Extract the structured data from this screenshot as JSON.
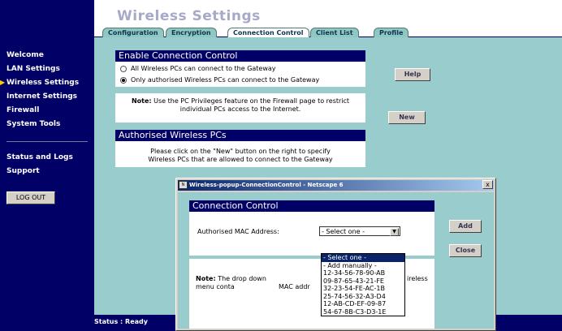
{
  "page_title": "Wireless Settings",
  "tabs": [
    "Configuration",
    "Encryption",
    "Connection Control",
    "Client List",
    "Profile"
  ],
  "sidebar": {
    "items": [
      "Welcome",
      "LAN Settings",
      "Wireless Settings",
      "Internet Settings",
      "Firewall",
      "System Tools"
    ],
    "items2": [
      "Status and Logs",
      "Support"
    ],
    "active_item": "Wireless Settings",
    "logout": "LOG OUT"
  },
  "enable_section": {
    "heading": "Enable Connection Control",
    "option_all": "All Wireless PCs can connect to the Gateway",
    "option_authorised": "Only authorised Wireless PCs can connect to the Gateway",
    "selected": "option_authorised"
  },
  "note": {
    "label": "Note:",
    "line1": "Use the PC Privileges feature on the Firewall page to restrict",
    "line2": "individual PCs access to the Internet."
  },
  "authorised_section": {
    "heading": "Authorised Wireless PCs",
    "line1": "Please click on the \"New\" button on the right to specify",
    "line2": "Wireless PCs that are allowed to connect to the Gateway"
  },
  "buttons": {
    "help": "Help",
    "new": "New"
  },
  "status": "Status : Ready",
  "popup": {
    "title": "Wireless-popup-ConnectionControl - Netscape 6",
    "close": "x",
    "heading": "Connection Control",
    "field_label": "Authorised MAC Address:",
    "selected": "- Select one -",
    "options": [
      "- Select one -",
      "- Add manually -",
      "12-34-56-78-90-AB",
      "09-87-65-43-21-FE",
      "32-23-54-FE-AC-1B",
      "25-74-56-32-A3-D4",
      "12-AB-CD-EF-09-87",
      "54-67-8B-C3-D3-1E"
    ],
    "add": "Add",
    "close_button": "Close",
    "note_label": "Note:",
    "note_line1": "The drop down menu conta",
    "note_line1_end": "ireless",
    "note_line2": "MAC addr"
  },
  "colors": {
    "navy": "#000066",
    "teal": "#99cccc",
    "tab": "#8fc8c0"
  }
}
